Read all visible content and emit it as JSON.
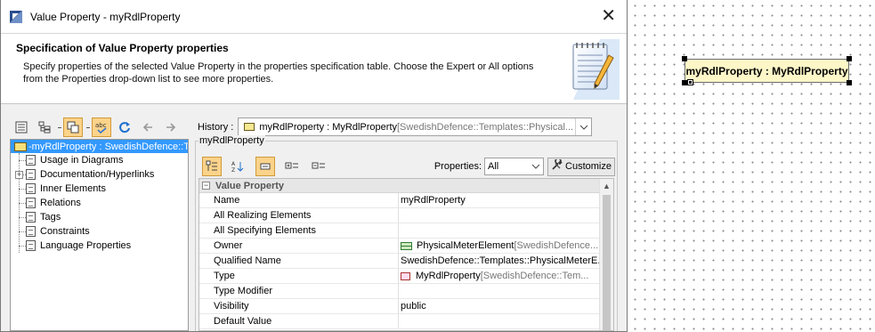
{
  "window": {
    "title": "Value Property - myRdlProperty",
    "close_glyph": "✕"
  },
  "header": {
    "title": "Specification of Value Property properties",
    "description": "Specify properties of the selected Value Property in the properties specification table. Choose the Expert or All options from the Properties drop-down list to see more properties."
  },
  "tree": {
    "root_label": "-myRdlProperty : SwedishDefence::T",
    "items": [
      {
        "label": "Usage in Diagrams",
        "expandable": false
      },
      {
        "label": "Documentation/Hyperlinks",
        "expandable": true
      },
      {
        "label": "Inner Elements",
        "expandable": false
      },
      {
        "label": "Relations",
        "expandable": false
      },
      {
        "label": "Tags",
        "expandable": false
      },
      {
        "label": "Constraints",
        "expandable": false
      },
      {
        "label": "Language Properties",
        "expandable": false
      }
    ]
  },
  "history": {
    "label": "History :",
    "value_main": "myRdlProperty : MyRdlProperty",
    "value_grey": " [SwedishDefence::Templates::Physical..."
  },
  "group_title": "myRdlProperty",
  "properties_filter": {
    "label": "Properties:",
    "selected": "All",
    "customize_label": "Customize"
  },
  "table": {
    "section_title": "Value Property",
    "rows": [
      {
        "name": "Name",
        "value": "myRdlProperty",
        "icon": ""
      },
      {
        "name": "All Realizing Elements",
        "value": "",
        "icon": ""
      },
      {
        "name": "All Specifying Elements",
        "value": "",
        "icon": ""
      },
      {
        "name": "Owner",
        "value": "PhysicalMeterElement",
        "grey": " [SwedishDefence...",
        "icon": "element"
      },
      {
        "name": "Qualified Name",
        "value": "SwedishDefence::Templates::PhysicalMeterE...",
        "icon": ""
      },
      {
        "name": "Type",
        "value": "MyRdlProperty",
        "grey": " [SwedishDefence::Tem...",
        "icon": "type"
      },
      {
        "name": "Type Modifier",
        "value": "",
        "icon": ""
      },
      {
        "name": "Visibility",
        "value": "public",
        "icon": ""
      },
      {
        "name": "Default Value",
        "value": "",
        "icon": ""
      }
    ]
  },
  "diagram": {
    "element_label": "myRdlProperty : MyRdlProperty"
  },
  "colors": {
    "selection": "#3399ff",
    "toggle_active": "#fbd38a",
    "diagram_fill": "#fdf7c8"
  }
}
